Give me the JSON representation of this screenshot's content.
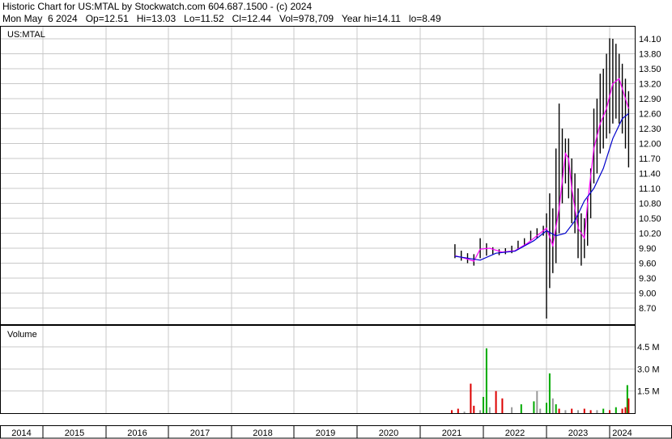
{
  "header": {
    "line1": "Historic Chart for US:MTAL by Stockwatch.com 604.687.1500 - (c) 2024",
    "line2": "Mon May  6 2024   Op=12.51   Hi=13.03   Lo=11.52   Cl=12.44   Vol=978,709   Year hi=14.11   lo=8.49"
  },
  "chart_data": [
    {
      "type": "line",
      "panel": "price",
      "title": "US:MTAL",
      "y_ticks": [
        "14.10",
        "13.80",
        "13.50",
        "13.20",
        "12.90",
        "12.60",
        "12.30",
        "12.00",
        "11.70",
        "11.40",
        "11.10",
        "10.80",
        "10.50",
        "10.20",
        "9.90",
        "9.60",
        "9.30",
        "9.00",
        "8.70"
      ],
      "ylim": [
        8.4,
        14.3
      ],
      "x_ticks": [
        "2014",
        "2015",
        "2016",
        "2017",
        "2018",
        "2019",
        "2020",
        "2021",
        "2022",
        "2023",
        "2024"
      ],
      "xlim": [
        2013.7,
        2024.4
      ],
      "grid": true,
      "series": [
        {
          "style": "high-low-bars",
          "color": "#000000",
          "x": [
            2021.55,
            2021.65,
            2021.75,
            2021.85,
            2021.95,
            2022.05,
            2022.15,
            2022.25,
            2022.35,
            2022.45,
            2022.55,
            2022.65,
            2022.75,
            2022.85,
            2022.95,
            2023.0,
            2023.05,
            2023.1,
            2023.15,
            2023.2,
            2023.25,
            2023.3,
            2023.35,
            2023.4,
            2023.45,
            2023.5,
            2023.55,
            2023.6,
            2023.65,
            2023.7,
            2023.75,
            2023.8,
            2023.85,
            2023.9,
            2023.95,
            2024.0,
            2024.05,
            2024.1,
            2024.15,
            2024.2,
            2024.25,
            2024.3
          ],
          "high": [
            9.98,
            9.85,
            9.8,
            9.78,
            10.1,
            10.0,
            9.92,
            9.88,
            9.9,
            9.95,
            10.05,
            10.1,
            10.25,
            10.3,
            10.35,
            10.6,
            11.0,
            10.7,
            11.9,
            12.8,
            12.3,
            12.1,
            12.1,
            11.7,
            11.4,
            11.1,
            10.6,
            10.5,
            10.9,
            11.5,
            12.7,
            12.9,
            13.4,
            13.5,
            13.8,
            14.11,
            14.1,
            14.0,
            13.8,
            13.6,
            13.3,
            13.05
          ],
          "low": [
            9.7,
            9.65,
            9.6,
            9.55,
            9.7,
            9.75,
            9.78,
            9.76,
            9.78,
            9.8,
            9.88,
            9.95,
            10.05,
            10.1,
            10.15,
            8.49,
            9.1,
            9.4,
            9.6,
            10.2,
            10.8,
            11.2,
            10.9,
            10.4,
            10.2,
            9.7,
            9.55,
            9.7,
            9.95,
            10.5,
            11.2,
            11.4,
            11.8,
            11.9,
            12.1,
            12.2,
            12.4,
            12.5,
            12.4,
            12.2,
            11.9,
            11.52
          ]
        },
        {
          "style": "moving-average",
          "color": "#ff00ff",
          "x": [
            2021.55,
            2021.7,
            2021.85,
            2021.95,
            2022.1,
            2022.3,
            2022.5,
            2022.7,
            2022.9,
            2023.0,
            2023.1,
            2023.2,
            2023.3,
            2023.35,
            2023.4,
            2023.5,
            2023.6,
            2023.65,
            2023.75,
            2023.85,
            2023.95,
            2024.05,
            2024.15,
            2024.25,
            2024.3
          ],
          "values": [
            9.75,
            9.7,
            9.64,
            9.88,
            9.9,
            9.82,
            9.85,
            10.0,
            10.2,
            10.3,
            9.95,
            10.7,
            11.8,
            11.7,
            11.1,
            10.3,
            10.1,
            10.8,
            11.9,
            12.4,
            12.7,
            13.2,
            13.3,
            12.9,
            12.7
          ]
        },
        {
          "style": "moving-average",
          "color": "#0000cc",
          "x": [
            2021.55,
            2021.75,
            2021.95,
            2022.2,
            2022.5,
            2022.8,
            2023.0,
            2023.15,
            2023.3,
            2023.45,
            2023.6,
            2023.75,
            2023.9,
            2024.05,
            2024.2,
            2024.3
          ],
          "values": [
            9.74,
            9.7,
            9.66,
            9.8,
            9.84,
            10.05,
            10.25,
            10.15,
            10.2,
            10.45,
            10.85,
            11.1,
            11.5,
            12.1,
            12.5,
            12.6
          ]
        }
      ]
    },
    {
      "type": "bar",
      "panel": "volume",
      "title": "Volume",
      "y_ticks": [
        "4.5 M",
        "3.0 M",
        "1.5 M"
      ],
      "ylim": [
        0,
        5.6
      ],
      "unit": "M",
      "colors": {
        "up": "#00aa00",
        "down": "#dd0000",
        "flat": "#999999"
      },
      "bars": [
        {
          "x": 2021.5,
          "v": 0.2,
          "c": "down"
        },
        {
          "x": 2021.6,
          "v": 0.3,
          "c": "down"
        },
        {
          "x": 2021.7,
          "v": 0.1,
          "c": "flat"
        },
        {
          "x": 2021.8,
          "v": 2.0,
          "c": "down"
        },
        {
          "x": 2021.85,
          "v": 0.5,
          "c": "down"
        },
        {
          "x": 2021.95,
          "v": 0.2,
          "c": "flat"
        },
        {
          "x": 2022.0,
          "v": 1.1,
          "c": "up"
        },
        {
          "x": 2022.05,
          "v": 4.4,
          "c": "up"
        },
        {
          "x": 2022.1,
          "v": 0.4,
          "c": "flat"
        },
        {
          "x": 2022.2,
          "v": 1.5,
          "c": "down"
        },
        {
          "x": 2022.3,
          "v": 1.0,
          "c": "down"
        },
        {
          "x": 2022.45,
          "v": 0.4,
          "c": "flat"
        },
        {
          "x": 2022.6,
          "v": 0.6,
          "c": "up"
        },
        {
          "x": 2022.8,
          "v": 0.8,
          "c": "up"
        },
        {
          "x": 2022.85,
          "v": 1.5,
          "c": "flat"
        },
        {
          "x": 2022.9,
          "v": 0.3,
          "c": "flat"
        },
        {
          "x": 2023.0,
          "v": 0.7,
          "c": "up"
        },
        {
          "x": 2023.05,
          "v": 2.7,
          "c": "up"
        },
        {
          "x": 2023.1,
          "v": 1.0,
          "c": "flat"
        },
        {
          "x": 2023.15,
          "v": 0.6,
          "c": "up"
        },
        {
          "x": 2023.2,
          "v": 0.3,
          "c": "down"
        },
        {
          "x": 2023.3,
          "v": 0.2,
          "c": "flat"
        },
        {
          "x": 2023.4,
          "v": 0.3,
          "c": "down"
        },
        {
          "x": 2023.5,
          "v": 0.2,
          "c": "flat"
        },
        {
          "x": 2023.6,
          "v": 0.3,
          "c": "down"
        },
        {
          "x": 2023.7,
          "v": 0.2,
          "c": "down"
        },
        {
          "x": 2023.8,
          "v": 0.2,
          "c": "flat"
        },
        {
          "x": 2023.9,
          "v": 0.3,
          "c": "up"
        },
        {
          "x": 2024.0,
          "v": 0.2,
          "c": "down"
        },
        {
          "x": 2024.1,
          "v": 0.4,
          "c": "up"
        },
        {
          "x": 2024.2,
          "v": 0.3,
          "c": "down"
        },
        {
          "x": 2024.25,
          "v": 0.4,
          "c": "down"
        },
        {
          "x": 2024.28,
          "v": 1.9,
          "c": "up"
        },
        {
          "x": 2024.3,
          "v": 1.0,
          "c": "down"
        }
      ]
    }
  ]
}
